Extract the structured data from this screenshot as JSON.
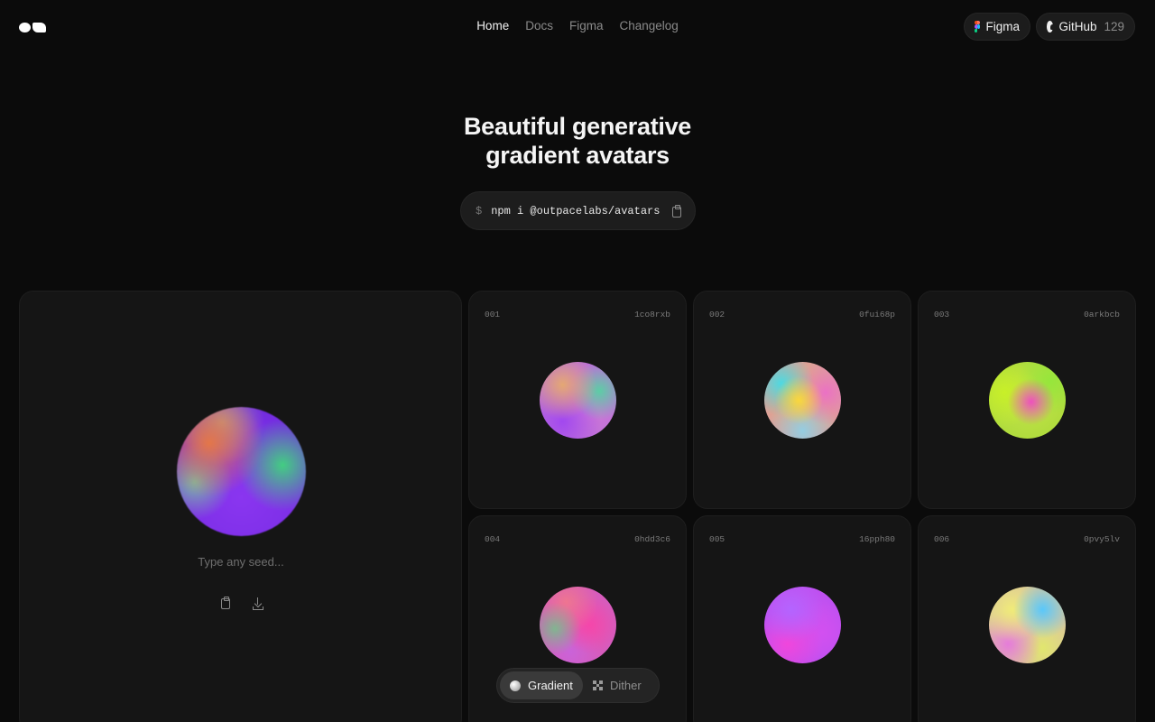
{
  "header": {
    "nav": [
      "Home",
      "Docs",
      "Figma",
      "Changelog"
    ],
    "active_nav": "Home",
    "figma_label": "Figma",
    "github_label": "GitHub",
    "github_stars": "129"
  },
  "hero": {
    "title_line1": "Beautiful generative",
    "title_line2": "gradient avatars",
    "prompt": "$",
    "install_cmd": "npm i @outpacelabs/avatars"
  },
  "editor": {
    "seed_placeholder": "Type any seed..."
  },
  "avatars": [
    {
      "num": "001",
      "seed": "1co8rxb"
    },
    {
      "num": "002",
      "seed": "0fui68p"
    },
    {
      "num": "003",
      "seed": "0arkbcb"
    },
    {
      "num": "004",
      "seed": "0hdd3c6"
    },
    {
      "num": "005",
      "seed": "16pph80"
    },
    {
      "num": "006",
      "seed": "0pvy5lv"
    }
  ],
  "mode_toggle": {
    "options": [
      "Gradient",
      "Dither"
    ],
    "selected": "Gradient"
  },
  "colors": {
    "background": "#0b0b0b",
    "card": "#151515",
    "accent_text": "#f5f5f5",
    "muted_text": "#8a8a8a"
  }
}
